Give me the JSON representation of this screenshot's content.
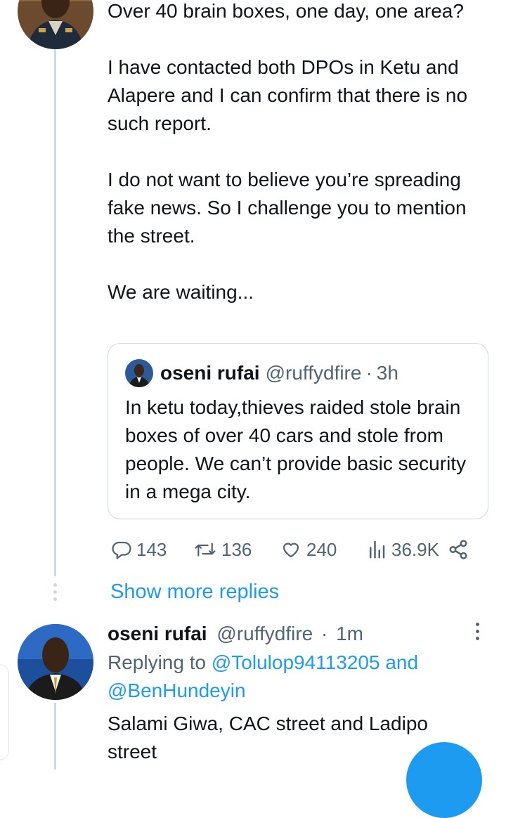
{
  "main_tweet": {
    "paragraphs": [
      "Over 40 brain boxes, one day, one area?",
      "I have contacted both DPOs in Ketu and Alapere and I can confirm that there is no such report.",
      "I do not want to believe you’re spreading fake news. So I challenge you to mention the street.",
      "We are waiting..."
    ]
  },
  "quoted_tweet": {
    "author_name": "oseni rufai",
    "handle": "@ruffydfire",
    "separator": "·",
    "time": "3h",
    "text": "In ketu today,thieves raided stole brain boxes of over 40 cars and stole from people. We can’t provide basic security in a mega city."
  },
  "actions": {
    "replies": "143",
    "retweets": "136",
    "likes": "240",
    "views": "36.9K"
  },
  "show_more_label": "Show more replies",
  "reply": {
    "author_name": "oseni rufai",
    "handle": "@ruffydfire",
    "separator": "·",
    "time": "1m",
    "replying_prefix": "Replying to",
    "replying_user1": "@Tolulop94113205",
    "replying_and": "and",
    "replying_user2": "@BenHundeyin",
    "text": "Salami Giwa, CAC street and Ladipo street"
  },
  "colors": {
    "accent": "#1d9bf0",
    "text": "#0f1419",
    "secondary_text": "#536471",
    "border": "#cfd9de"
  },
  "icons": [
    "reply-icon",
    "retweet-icon",
    "like-icon",
    "views-icon",
    "share-icon",
    "more-options-icon"
  ]
}
